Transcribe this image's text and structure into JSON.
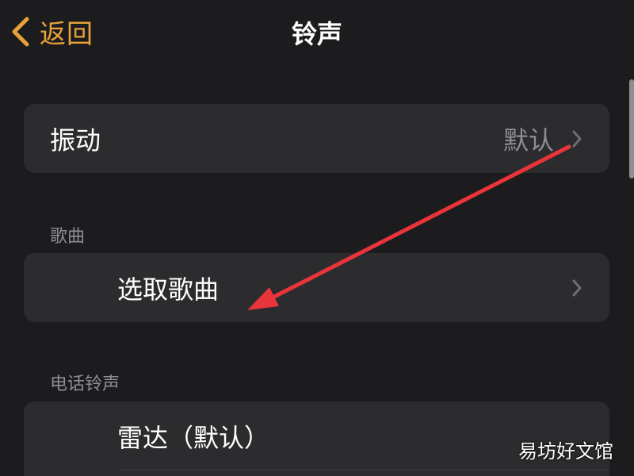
{
  "nav": {
    "back_label": "返回",
    "title": "铃声"
  },
  "vibration_row": {
    "label": "振动",
    "value": "默认"
  },
  "songs_section": {
    "header": "歌曲",
    "pick_song_label": "选取歌曲"
  },
  "ringtone_section": {
    "header": "电话铃声",
    "items": [
      {
        "label": "雷达（默认）"
      }
    ]
  },
  "watermark": "易坊好文馆",
  "colors": {
    "background": "#1c1c1e",
    "cell": "#2c2c2e",
    "accent": "#e9a23b",
    "secondary_text": "#8e8e93",
    "annotation_arrow": "#e8343a"
  },
  "icons": {
    "back": "chevron-left-icon",
    "disclosure": "chevron-right-icon"
  }
}
